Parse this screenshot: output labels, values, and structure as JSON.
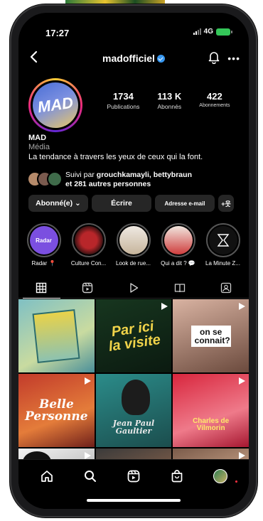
{
  "status": {
    "time": "17:27",
    "network": "4G"
  },
  "header": {
    "username": "madofficiel"
  },
  "profile": {
    "avatar_text": "MAD",
    "stats": [
      {
        "value": "1734",
        "label": "Publications"
      },
      {
        "value": "113 K",
        "label": "Abonnés"
      },
      {
        "value": "422",
        "label": "Abonnements"
      }
    ]
  },
  "bio": {
    "name": "MAD",
    "category": "Média",
    "text": "La tendance à travers les yeux de ceux qui la font."
  },
  "followed": {
    "prefix": "Suivi par",
    "names": "grouchkamayli, bettybraun",
    "line2": "et 281 autres personnes"
  },
  "actions": {
    "follow": "Abonné(e) ⌄",
    "write": "Écrire",
    "email": "Adresse e-mail",
    "add": "+웃"
  },
  "highlights": [
    {
      "label": "Radar 📍",
      "color": "#7b4fe0"
    },
    {
      "label": "Culture Con...",
      "color": "#8a1d1d"
    },
    {
      "label": "Look de rue...",
      "color": "#e9e4de"
    },
    {
      "label": "Qui a dit ? 💬",
      "color": "#cf3d3d"
    },
    {
      "label": "La Minute Z...",
      "color": "#111111"
    }
  ],
  "grid": [
    {
      "bg": "linear-gradient(150deg,#7fc0c4,#c9dba0 60%,#4a8f9a)",
      "reel": false,
      "text": "",
      "text_color": "#ffffff"
    },
    {
      "bg": "linear-gradient(160deg,#17361f,#0b1a10)",
      "reel": true,
      "text": "Par ici la visite",
      "text_color": "#f0d34a"
    },
    {
      "bg": "linear-gradient(160deg,#d9b3a2,#6b4a3d)",
      "reel": true,
      "text": "on se connait?",
      "text_color": "#111111"
    },
    {
      "bg": "linear-gradient(160deg,#c23b2b,#e47c3a 60%,#6e1f1a)",
      "reel": true,
      "text": "Belle Personne",
      "text_color": "#ffffff"
    },
    {
      "bg": "linear-gradient(160deg,#2b8c8a,#1b4d4d)",
      "reel": false,
      "text": "Jean Paul Gaultier",
      "text_color": "#e9e9e9"
    },
    {
      "bg": "linear-gradient(160deg,#d8263d,#ef7a8a 60%,#a51730)",
      "reel": true,
      "text": "Charles de Vilmorin",
      "text_color": "#ffe86b"
    },
    {
      "bg": "linear-gradient(160deg,#f2f2f2,#bfbfbf)",
      "reel": true,
      "text": "",
      "text_color": "#000000"
    },
    {
      "bg": "linear-gradient(160deg,#3a3a3a,#7a5b48)",
      "reel": false,
      "text": "",
      "text_color": "#ffffff"
    },
    {
      "bg": "linear-gradient(160deg,#7a5b4a,#c09a80)",
      "reel": true,
      "text": "",
      "text_color": "#ffffff"
    }
  ]
}
